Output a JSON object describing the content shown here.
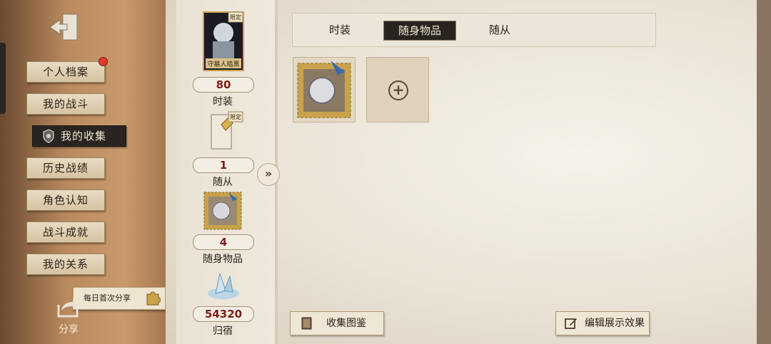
{
  "sidebar": {
    "items": [
      {
        "label": "个人档案",
        "badge": true
      },
      {
        "label": "我的战斗"
      },
      {
        "label": "我的收集",
        "active": true
      },
      {
        "label": "历史战绩"
      },
      {
        "label": "角色认知"
      },
      {
        "label": "战斗成就"
      },
      {
        "label": "我的关系"
      }
    ],
    "share_tip": "每日首次分享",
    "share_label": "分享",
    "exit_icon": "exit-door-icon"
  },
  "stats": [
    {
      "value": "80",
      "label": "时装",
      "tag": "限定",
      "card_caption": "守墓人暗黑"
    },
    {
      "value": "1",
      "label": "随从",
      "tag": "限定"
    },
    {
      "value": "4",
      "label": "随身物品"
    },
    {
      "value": "54320",
      "label": "归宿"
    }
  ],
  "tabs": [
    {
      "label": "时装"
    },
    {
      "label": "随身物品",
      "active": true
    },
    {
      "label": "随从"
    }
  ],
  "buttons": {
    "catalog": "收集图鉴",
    "edit_display": "编辑展示效果"
  },
  "colors": {
    "accent_dark": "#2a2420",
    "value_red": "#7a1e18",
    "parchment": "#eae3d6",
    "badge_red": "#e23a2a"
  }
}
